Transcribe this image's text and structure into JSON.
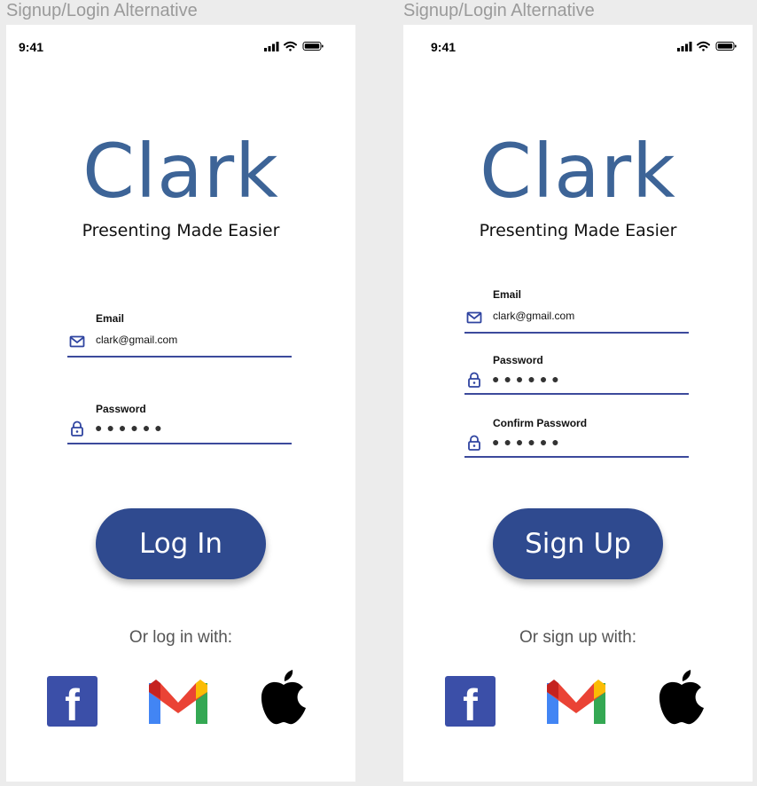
{
  "frames": [
    {
      "frame_label": "Signup/Login Alternative",
      "status": {
        "time": "9:41"
      },
      "brand": {
        "name": "Clark",
        "tagline": "Presenting Made Easier"
      },
      "fields": [
        {
          "label": "Email",
          "value": "clark@gmail.com",
          "icon": "mail-icon"
        },
        {
          "label": "Password",
          "masked": "●●●●●●",
          "icon": "lock-icon"
        }
      ],
      "cta_label": "Log In",
      "alt_text": "Or log in with:",
      "social": [
        "facebook-icon",
        "gmail-icon",
        "apple-icon"
      ]
    },
    {
      "frame_label": "Signup/Login Alternative",
      "status": {
        "time": "9:41"
      },
      "brand": {
        "name": "Clark",
        "tagline": "Presenting Made Easier"
      },
      "fields": [
        {
          "label": "Email",
          "value": "clark@gmail.com",
          "icon": "mail-icon"
        },
        {
          "label": "Password",
          "masked": "●●●●●●",
          "icon": "lock-icon"
        },
        {
          "label": "Confirm Password",
          "masked": "●●●●●●",
          "icon": "lock-icon"
        }
      ],
      "cta_label": "Sign Up",
      "alt_text": "Or sign up with:",
      "social": [
        "facebook-icon",
        "gmail-icon",
        "apple-icon"
      ]
    }
  ],
  "colors": {
    "brand_blue": "#3d6497",
    "button_blue": "#2f4a8f",
    "underline": "#3c4a9c",
    "facebook": "#3b4fa8"
  }
}
